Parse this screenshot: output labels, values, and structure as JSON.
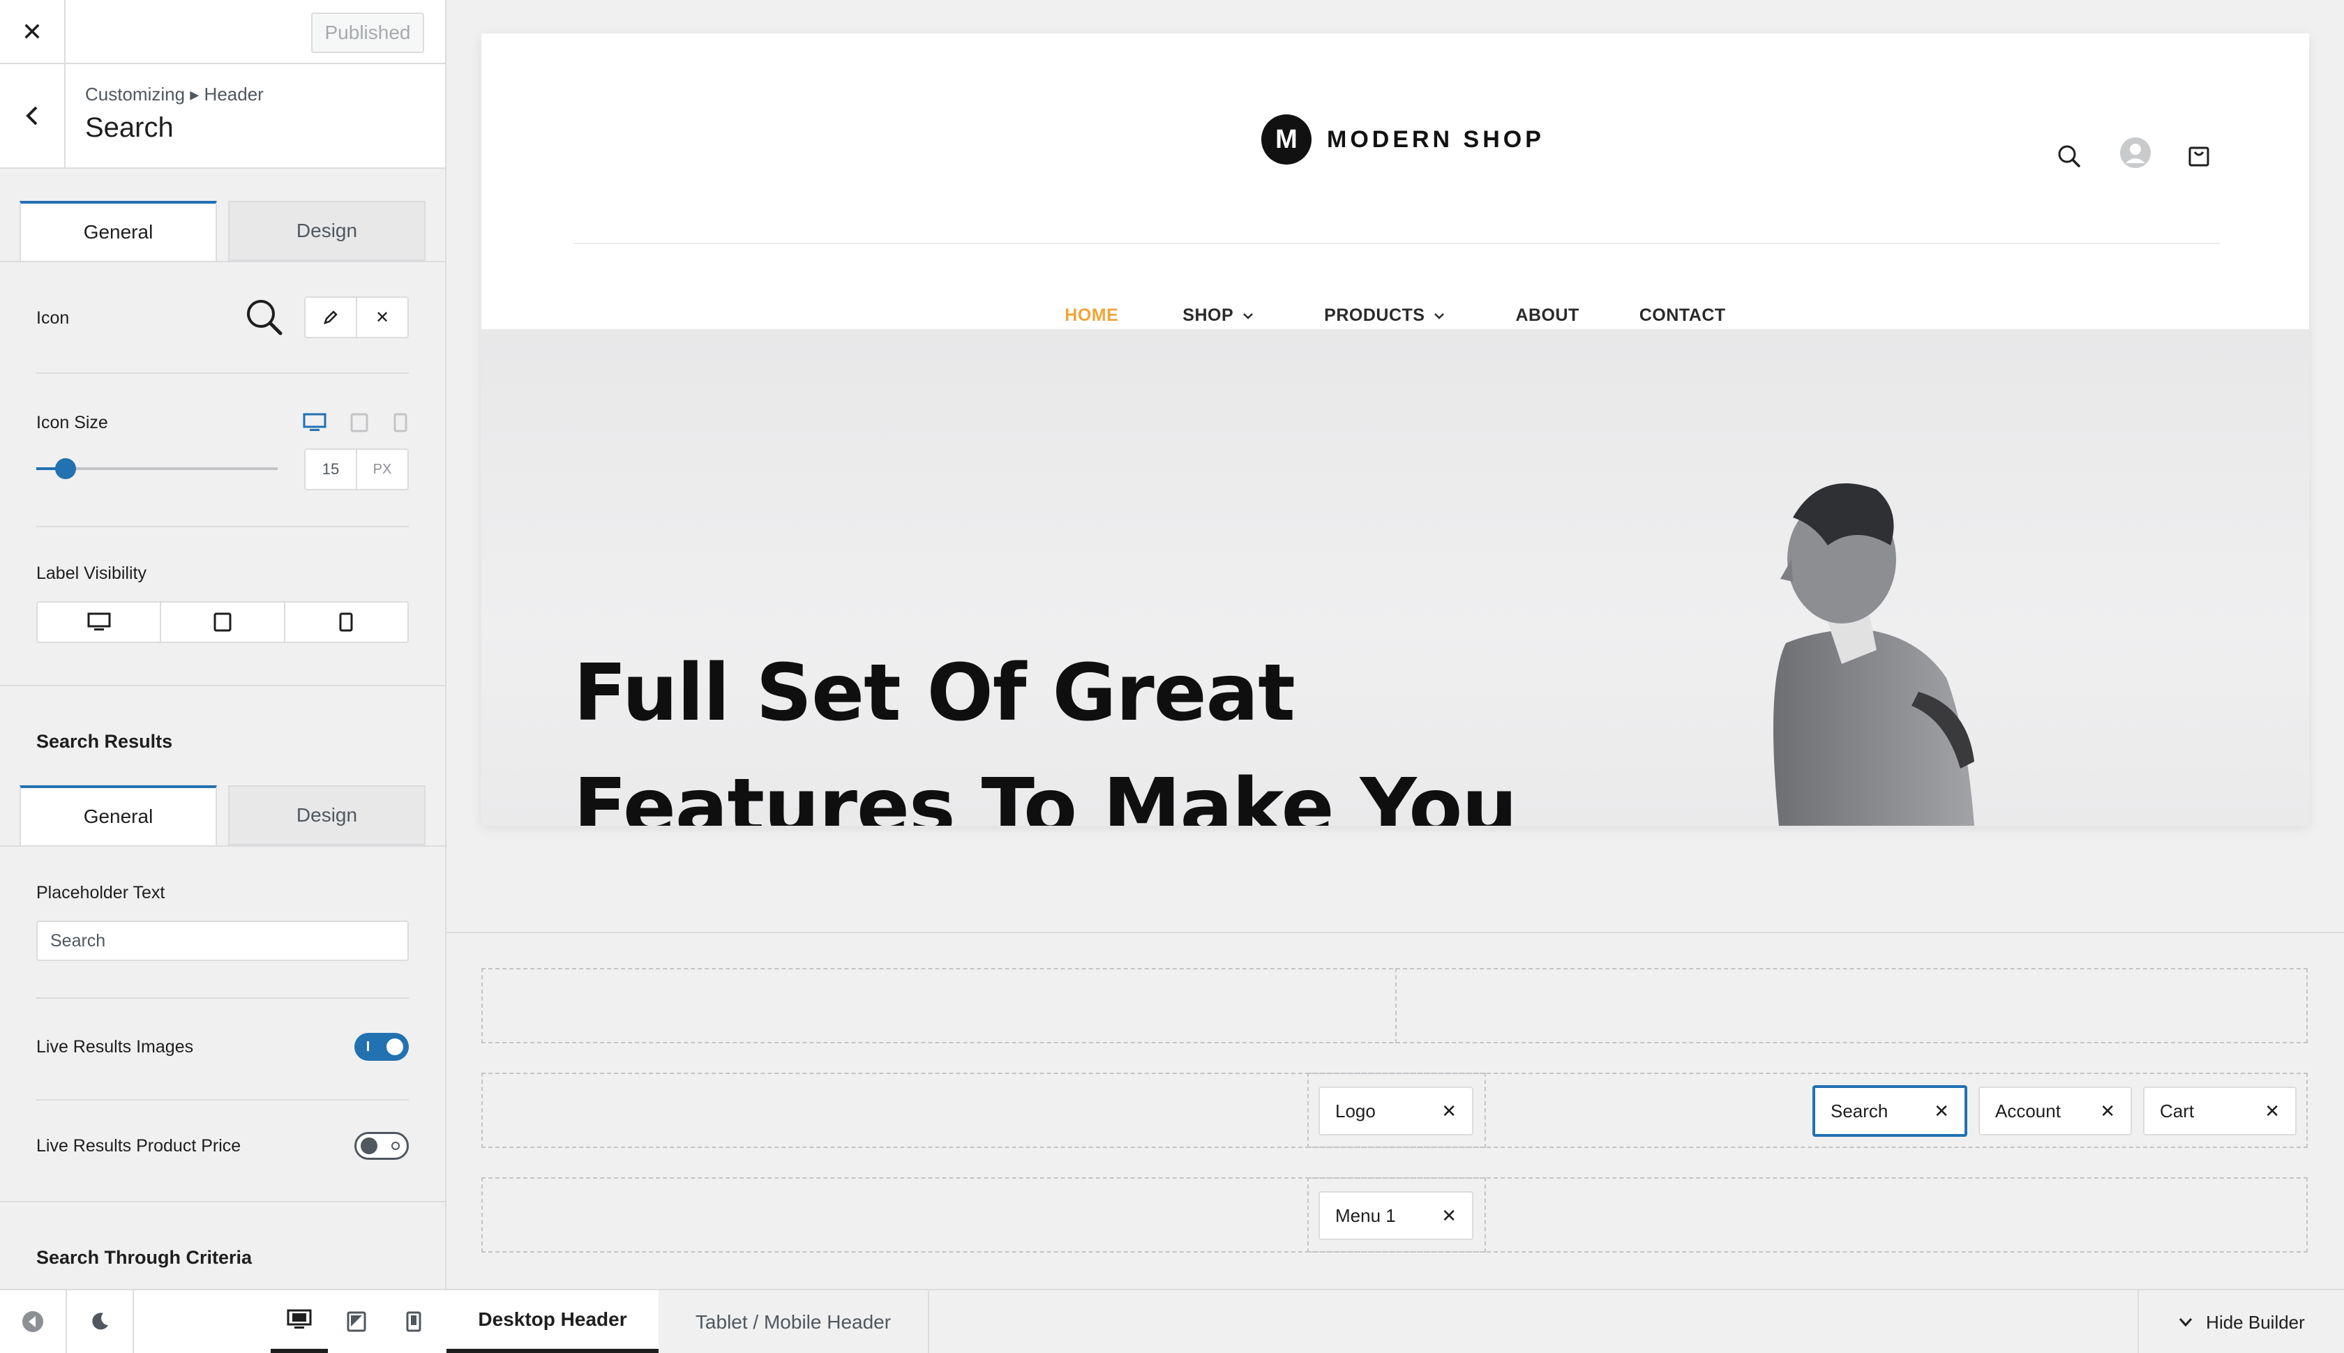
{
  "topbar": {
    "close_icon": "close-icon",
    "published_label": "Published"
  },
  "breadcrumb": {
    "path": "Customizing ▸ Header",
    "title": "Search",
    "back_icon": "chevron-left-icon"
  },
  "icon_tabs": {
    "general": "General",
    "design": "Design"
  },
  "icon_row": {
    "label": "Icon",
    "preview_icon": "search-icon",
    "edit_icon": "pencil-icon",
    "remove_icon": "close-icon"
  },
  "icon_size": {
    "label": "Icon Size",
    "value": "15",
    "unit": "PX",
    "slider_fraction": 0.12,
    "devices": [
      "desktop-icon",
      "tablet-icon",
      "mobile-icon"
    ]
  },
  "label_visibility": {
    "label": "Label Visibility",
    "options": [
      "desktop-icon",
      "tablet-icon",
      "mobile-icon"
    ]
  },
  "search_results": {
    "title": "Search Results",
    "tabs": {
      "general": "General",
      "design": "Design"
    },
    "placeholder_label": "Placeholder Text",
    "placeholder_value": "Search",
    "live_images_label": "Live Results Images",
    "live_images_on": true,
    "live_price_label": "Live Results Product Price",
    "live_price_on": false
  },
  "search_through": {
    "title": "Search Through Criteria"
  },
  "bottom_bar": {
    "devices": [
      "desktop-icon",
      "tablet-icon",
      "mobile-icon"
    ],
    "active_device": "desktop"
  },
  "site": {
    "logo_letter": "M",
    "logo_text": "MODERN SHOP",
    "header_icons": [
      "search-icon",
      "user-avatar-icon",
      "cart-icon"
    ],
    "nav": [
      {
        "label": "HOME",
        "active": true,
        "dropdown": false
      },
      {
        "label": "SHOP",
        "active": false,
        "dropdown": true
      },
      {
        "label": "PRODUCTS",
        "active": false,
        "dropdown": true
      },
      {
        "label": "ABOUT",
        "active": false,
        "dropdown": false
      },
      {
        "label": "CONTACT",
        "active": false,
        "dropdown": false
      }
    ],
    "hero_line1": "Full Set Of Great",
    "hero_line2": "Features To Make You"
  },
  "builder": {
    "row2": {
      "logo": "Logo",
      "search": "Search",
      "account": "Account",
      "cart": "Cart"
    },
    "row3": {
      "menu": "Menu 1"
    }
  },
  "builder_tabs": {
    "desktop": "Desktop Header",
    "tablet": "Tablet / Mobile Header",
    "hide": "Hide Builder"
  },
  "colors": {
    "accent": "#2271b1",
    "nav_active": "#f0a43a"
  }
}
